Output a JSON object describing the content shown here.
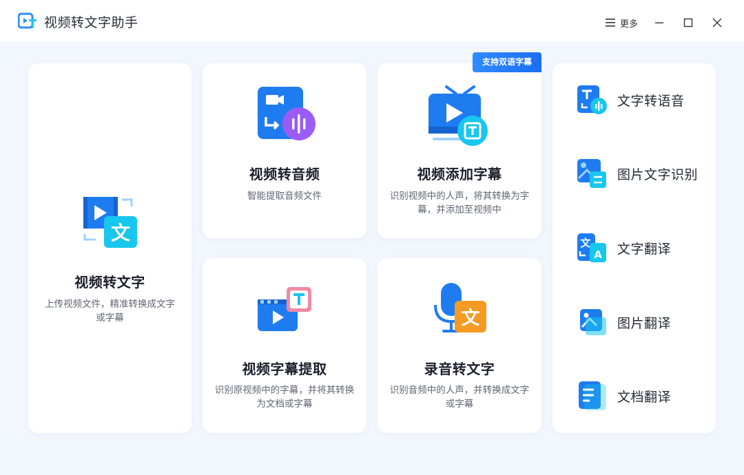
{
  "app": {
    "title": "视频转文字助手"
  },
  "window": {
    "more_label": "更多"
  },
  "cards": {
    "video_to_text": {
      "title": "视频转文字",
      "desc": "上传视频文件，精准转换成文字或字幕"
    },
    "video_to_audio": {
      "title": "视频转音频",
      "desc": "智能提取音频文件"
    },
    "add_subtitles": {
      "title": "视频添加字幕",
      "desc": "识别视频中的人声，将其转换为字幕，并添加至视频中",
      "badge": "支持双语字幕"
    },
    "extract_subtitles": {
      "title": "视频字幕提取",
      "desc": "识别原视频中的字幕，并将其转换为文档或字幕"
    },
    "audio_to_text": {
      "title": "录音转文字",
      "desc": "识别音频中的人声，并转换成文字或字幕"
    }
  },
  "sidebar": {
    "items": [
      {
        "label": "文字转语音",
        "icon": "text-to-speech-icon"
      },
      {
        "label": "图片文字识别",
        "icon": "image-ocr-icon"
      },
      {
        "label": "文字翻译",
        "icon": "text-translate-icon"
      },
      {
        "label": "图片翻译",
        "icon": "image-translate-icon"
      },
      {
        "label": "文档翻译",
        "icon": "document-translate-icon"
      }
    ]
  },
  "colors": {
    "accent": "#1b6df2",
    "background": "#f2f6fd",
    "cyan": "#20c8f0",
    "purple": "#8b5cf6",
    "orange": "#f59a23",
    "pink": "#f08aa3"
  }
}
